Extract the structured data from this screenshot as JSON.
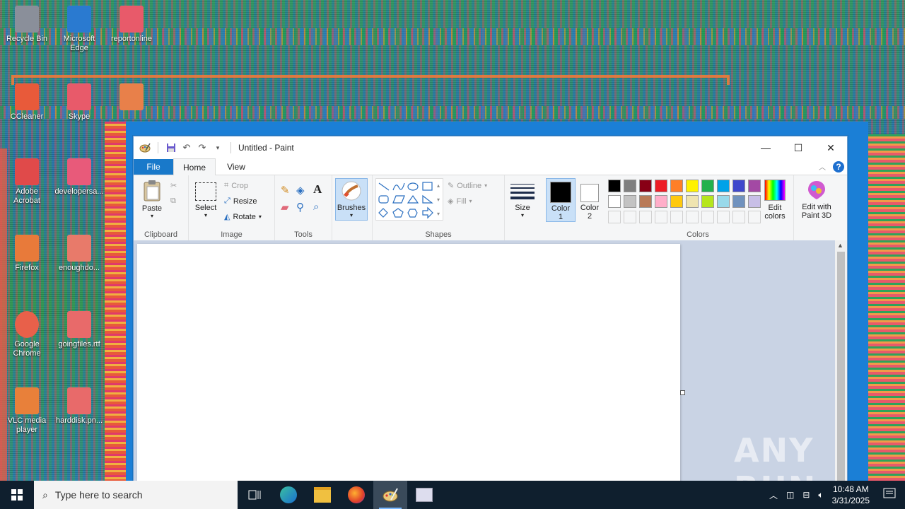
{
  "desktop": {
    "icons": [
      {
        "label": "Recycle Bin",
        "color": "#8a8f9a"
      },
      {
        "label": "Microsoft Edge",
        "color": "#2a7ad0"
      },
      {
        "label": "reportonline",
        "color": "#e85a6a"
      },
      {
        "label": "CCleaner",
        "color": "#e85a3a"
      },
      {
        "label": "Skype",
        "color": "#e85a6a"
      },
      {
        "label": "",
        "color": "#e8804a"
      },
      {
        "label": "Adobe Acrobat",
        "color": "#e04a4a"
      },
      {
        "label": "developersa...",
        "color": "#e85a7a"
      },
      {
        "label": "Firefox",
        "color": "#e87a3a"
      },
      {
        "label": "enoughdo...",
        "color": "#e87a6a"
      },
      {
        "label": "Google Chrome",
        "color": "#e8604a"
      },
      {
        "label": "goingfiles.rtf",
        "color": "#e86a6a"
      },
      {
        "label": "VLC media player",
        "color": "#e8803a"
      },
      {
        "label": "harddisk.pn...",
        "color": "#e86a6a"
      }
    ]
  },
  "paint": {
    "title": "Untitled - Paint",
    "tabs": {
      "file": "File",
      "home": "Home",
      "view": "View"
    },
    "clipboard": {
      "paste": "Paste",
      "label": "Clipboard"
    },
    "image": {
      "select": "Select",
      "crop": "Crop",
      "resize": "Resize",
      "rotate": "Rotate",
      "label": "Image"
    },
    "tools": {
      "label": "Tools"
    },
    "brushes": {
      "label": "Brushes"
    },
    "shapes": {
      "outline": "Outline",
      "fill": "Fill",
      "label": "Shapes"
    },
    "size": {
      "label": "Size"
    },
    "color1": {
      "label1": "Color",
      "label2": "1",
      "value": "#000000"
    },
    "color2": {
      "label1": "Color",
      "label2": "2",
      "value": "#ffffff"
    },
    "colors": {
      "label": "Colors",
      "palette_row1": [
        "#000000",
        "#7f7f7f",
        "#880015",
        "#ed1c24",
        "#ff7f27",
        "#fff200",
        "#22b14c",
        "#00a2e8",
        "#3f48cc",
        "#a349a4"
      ],
      "palette_row2": [
        "#ffffff",
        "#c3c3c3",
        "#b97a57",
        "#ffaec9",
        "#ffc90e",
        "#efe4b0",
        "#b5e61d",
        "#99d9ea",
        "#7092be",
        "#c8bfe7"
      ],
      "edit_label1": "Edit",
      "edit_label2": "colors"
    },
    "paint3d": {
      "label1": "Edit with",
      "label2": "Paint 3D"
    }
  },
  "taskbar": {
    "search_placeholder": "Type here to search",
    "time": "10:48 AM",
    "date": "3/31/2025"
  },
  "watermark": "ANY RUN"
}
